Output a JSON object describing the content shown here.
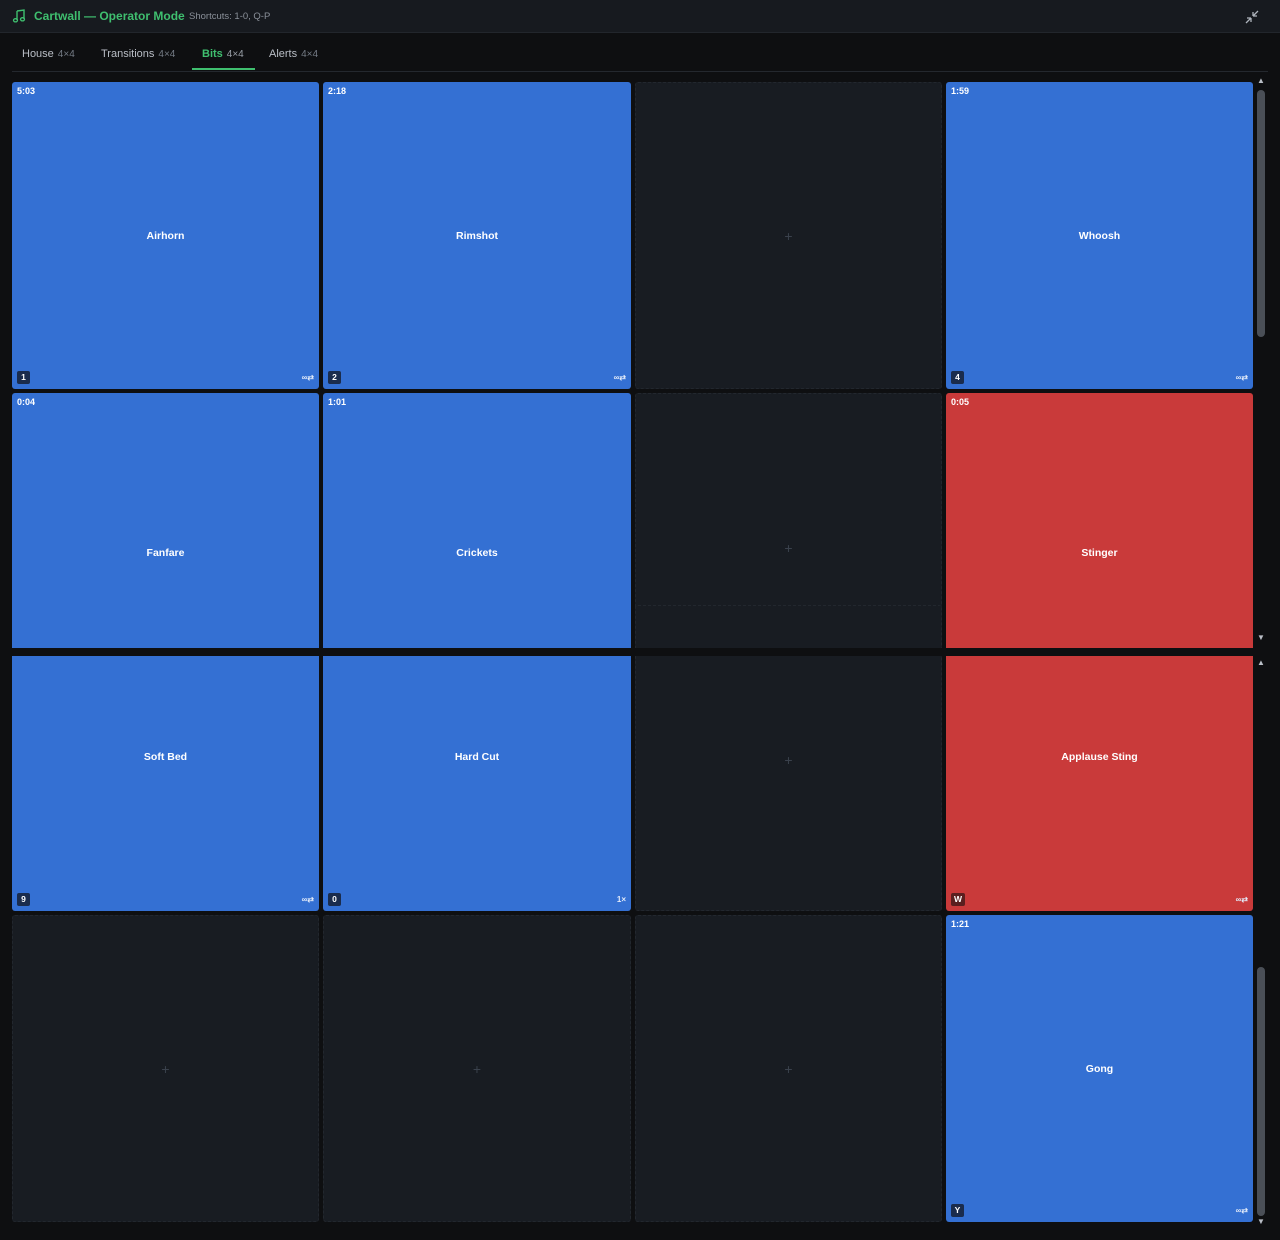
{
  "app": {
    "title": "Cartwall — Operator Mode",
    "shortcuts": "Shortcuts: 1-0, Q-P",
    "icon": "music-note-icon",
    "collapse_icon": "collapse-icon"
  },
  "tabs": [
    {
      "label": "House",
      "size": "4×4",
      "active": false
    },
    {
      "label": "Transitions",
      "size": "4×4",
      "active": false
    },
    {
      "label": "Bits",
      "size": "4×4",
      "active": true
    },
    {
      "label": "Alerts",
      "size": "4×4",
      "active": false
    }
  ],
  "pads": [
    {
      "name": "Airhorn",
      "duration": "5:03",
      "key": "1",
      "mode": "∞⇄",
      "color": "#3470d3"
    },
    {
      "name": "Rimshot",
      "duration": "2:18",
      "key": "2",
      "mode": "∞⇄",
      "color": "#3470d3"
    },
    {
      "empty": true,
      "symbol": "+"
    },
    {
      "name": "Whoosh",
      "duration": "1:59",
      "key": "4",
      "mode": "∞⇄",
      "color": "#3470d3"
    },
    {
      "name": "Fanfare",
      "duration": "0:04",
      "color": "#3470d3"
    },
    {
      "name": "Crickets",
      "duration": "1:01",
      "color": "#3470d3"
    },
    {
      "empty": true,
      "symbol": "+"
    },
    {
      "name": "Stinger",
      "duration": "0:05",
      "color": "#c93a3a"
    },
    {
      "name": "Soft Bed",
      "key": "9",
      "mode": "∞⇄",
      "color": "#3470d3"
    },
    {
      "name": "Hard Cut",
      "key": "0",
      "mode": "1×",
      "color": "#3470d3"
    },
    {
      "empty": true,
      "symbol": "+"
    },
    {
      "name": "Applause Sting",
      "key": "W",
      "mode": "∞⇄",
      "color": "#c93a3a"
    },
    {
      "empty": true,
      "symbol": "+"
    },
    {
      "empty": true,
      "symbol": "+"
    },
    {
      "empty": true,
      "symbol": "+"
    },
    {
      "name": "Gong",
      "duration": "1:21",
      "key": "Y",
      "mode": "∞⇄",
      "color": "#3470d3"
    }
  ],
  "scrollbar": {
    "up_arrow": "▲",
    "down_arrow": "▼"
  }
}
